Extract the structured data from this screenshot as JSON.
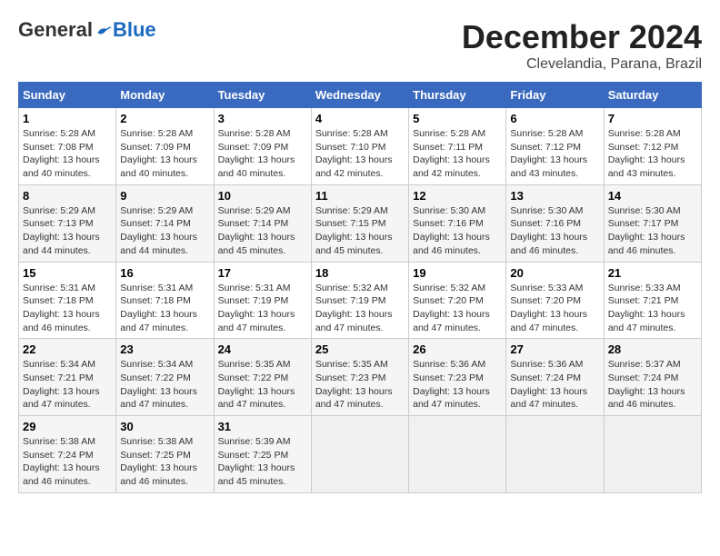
{
  "logo": {
    "general": "General",
    "blue": "Blue"
  },
  "title": "December 2024",
  "location": "Clevelandia, Parana, Brazil",
  "weekdays": [
    "Sunday",
    "Monday",
    "Tuesday",
    "Wednesday",
    "Thursday",
    "Friday",
    "Saturday"
  ],
  "weeks": [
    [
      {
        "day": "1",
        "sunrise": "5:28 AM",
        "sunset": "7:08 PM",
        "daylight": "13 hours and 40 minutes."
      },
      {
        "day": "2",
        "sunrise": "5:28 AM",
        "sunset": "7:09 PM",
        "daylight": "13 hours and 40 minutes."
      },
      {
        "day": "3",
        "sunrise": "5:28 AM",
        "sunset": "7:09 PM",
        "daylight": "13 hours and 40 minutes."
      },
      {
        "day": "4",
        "sunrise": "5:28 AM",
        "sunset": "7:10 PM",
        "daylight": "13 hours and 42 minutes."
      },
      {
        "day": "5",
        "sunrise": "5:28 AM",
        "sunset": "7:11 PM",
        "daylight": "13 hours and 42 minutes."
      },
      {
        "day": "6",
        "sunrise": "5:28 AM",
        "sunset": "7:12 PM",
        "daylight": "13 hours and 43 minutes."
      },
      {
        "day": "7",
        "sunrise": "5:28 AM",
        "sunset": "7:12 PM",
        "daylight": "13 hours and 43 minutes."
      }
    ],
    [
      {
        "day": "8",
        "sunrise": "5:29 AM",
        "sunset": "7:13 PM",
        "daylight": "13 hours and 44 minutes."
      },
      {
        "day": "9",
        "sunrise": "5:29 AM",
        "sunset": "7:14 PM",
        "daylight": "13 hours and 44 minutes."
      },
      {
        "day": "10",
        "sunrise": "5:29 AM",
        "sunset": "7:14 PM",
        "daylight": "13 hours and 45 minutes."
      },
      {
        "day": "11",
        "sunrise": "5:29 AM",
        "sunset": "7:15 PM",
        "daylight": "13 hours and 45 minutes."
      },
      {
        "day": "12",
        "sunrise": "5:30 AM",
        "sunset": "7:16 PM",
        "daylight": "13 hours and 46 minutes."
      },
      {
        "day": "13",
        "sunrise": "5:30 AM",
        "sunset": "7:16 PM",
        "daylight": "13 hours and 46 minutes."
      },
      {
        "day": "14",
        "sunrise": "5:30 AM",
        "sunset": "7:17 PM",
        "daylight": "13 hours and 46 minutes."
      }
    ],
    [
      {
        "day": "15",
        "sunrise": "5:31 AM",
        "sunset": "7:18 PM",
        "daylight": "13 hours and 46 minutes."
      },
      {
        "day": "16",
        "sunrise": "5:31 AM",
        "sunset": "7:18 PM",
        "daylight": "13 hours and 47 minutes."
      },
      {
        "day": "17",
        "sunrise": "5:31 AM",
        "sunset": "7:19 PM",
        "daylight": "13 hours and 47 minutes."
      },
      {
        "day": "18",
        "sunrise": "5:32 AM",
        "sunset": "7:19 PM",
        "daylight": "13 hours and 47 minutes."
      },
      {
        "day": "19",
        "sunrise": "5:32 AM",
        "sunset": "7:20 PM",
        "daylight": "13 hours and 47 minutes."
      },
      {
        "day": "20",
        "sunrise": "5:33 AM",
        "sunset": "7:20 PM",
        "daylight": "13 hours and 47 minutes."
      },
      {
        "day": "21",
        "sunrise": "5:33 AM",
        "sunset": "7:21 PM",
        "daylight": "13 hours and 47 minutes."
      }
    ],
    [
      {
        "day": "22",
        "sunrise": "5:34 AM",
        "sunset": "7:21 PM",
        "daylight": "13 hours and 47 minutes."
      },
      {
        "day": "23",
        "sunrise": "5:34 AM",
        "sunset": "7:22 PM",
        "daylight": "13 hours and 47 minutes."
      },
      {
        "day": "24",
        "sunrise": "5:35 AM",
        "sunset": "7:22 PM",
        "daylight": "13 hours and 47 minutes."
      },
      {
        "day": "25",
        "sunrise": "5:35 AM",
        "sunset": "7:23 PM",
        "daylight": "13 hours and 47 minutes."
      },
      {
        "day": "26",
        "sunrise": "5:36 AM",
        "sunset": "7:23 PM",
        "daylight": "13 hours and 47 minutes."
      },
      {
        "day": "27",
        "sunrise": "5:36 AM",
        "sunset": "7:24 PM",
        "daylight": "13 hours and 47 minutes."
      },
      {
        "day": "28",
        "sunrise": "5:37 AM",
        "sunset": "7:24 PM",
        "daylight": "13 hours and 46 minutes."
      }
    ],
    [
      {
        "day": "29",
        "sunrise": "5:38 AM",
        "sunset": "7:24 PM",
        "daylight": "13 hours and 46 minutes."
      },
      {
        "day": "30",
        "sunrise": "5:38 AM",
        "sunset": "7:25 PM",
        "daylight": "13 hours and 46 minutes."
      },
      {
        "day": "31",
        "sunrise": "5:39 AM",
        "sunset": "7:25 PM",
        "daylight": "13 hours and 45 minutes."
      },
      null,
      null,
      null,
      null
    ]
  ]
}
